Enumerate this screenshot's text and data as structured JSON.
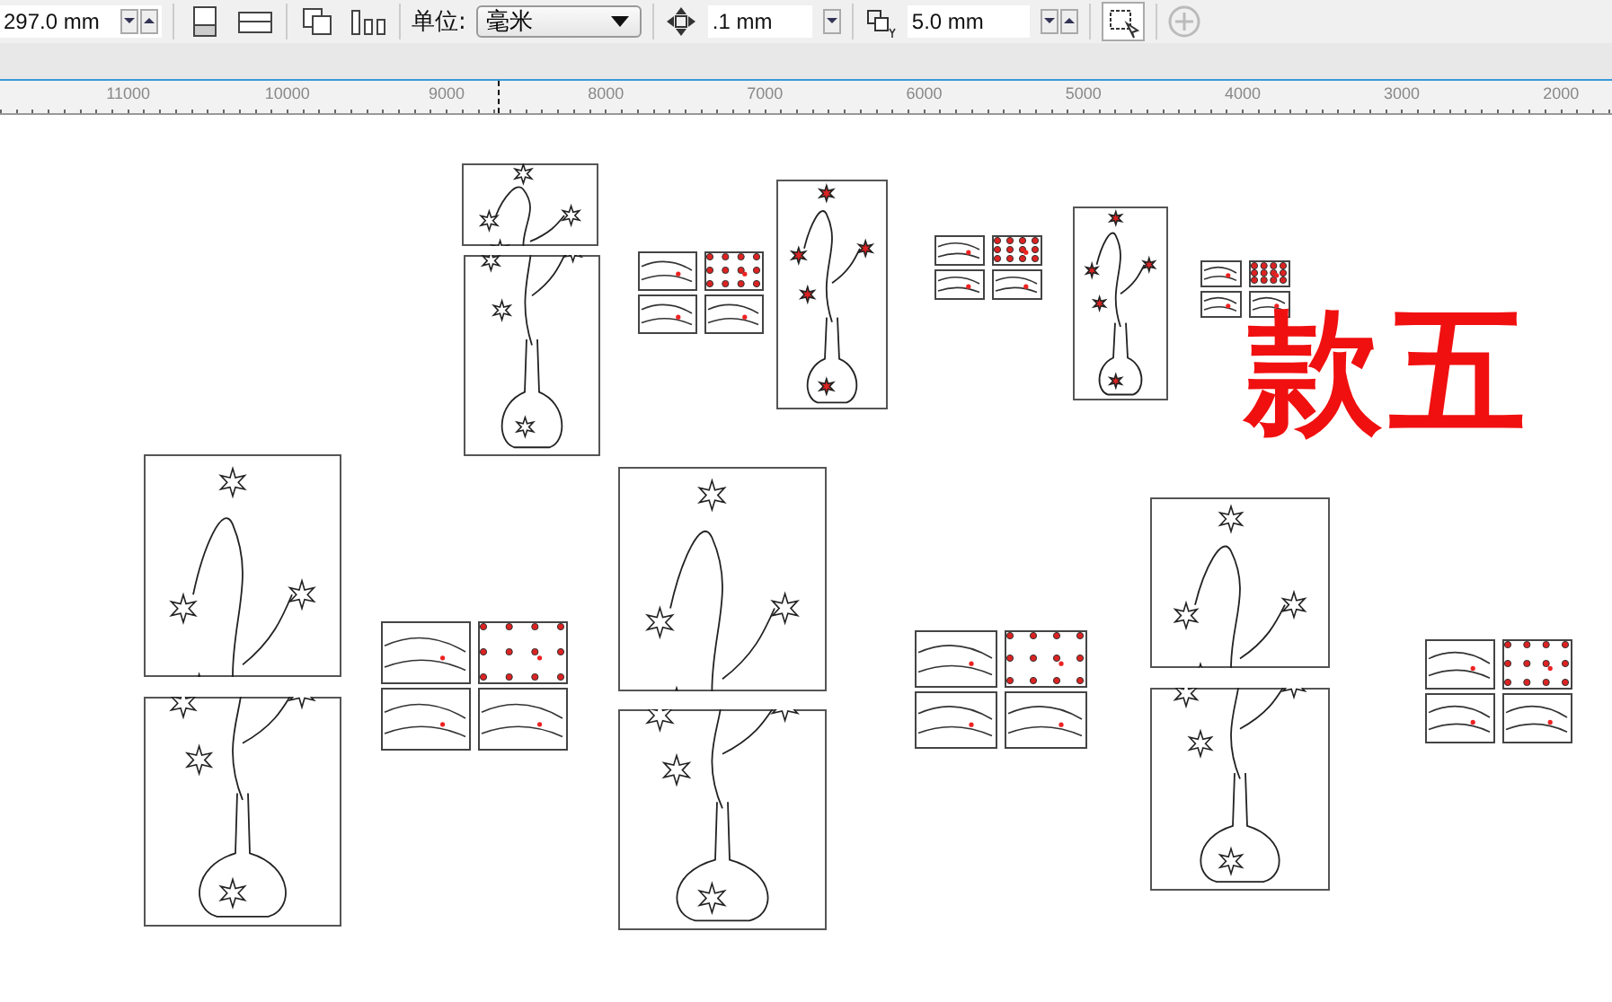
{
  "toolbar": {
    "page_height": "297.0 mm",
    "units_label": "单位:",
    "units_value": "毫米",
    "nudge": ".1 mm",
    "duplicate_y": "5.0 mm"
  },
  "ruler": {
    "labels": [
      "11000",
      "10000",
      "9000",
      "8000",
      "7000",
      "6000",
      "5000",
      "4000",
      "3000",
      "2000"
    ]
  },
  "canvas": {
    "label": "款五"
  }
}
